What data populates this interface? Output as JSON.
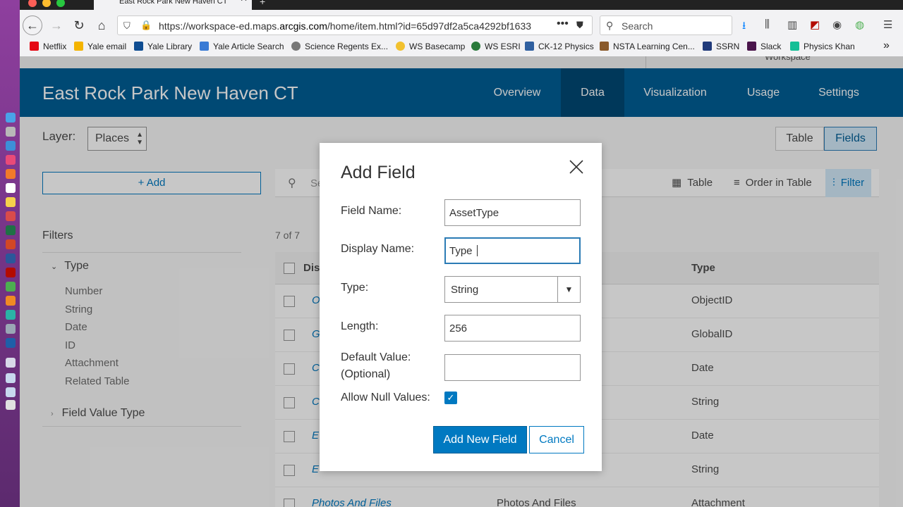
{
  "browser": {
    "tab_title": "East Rock Park New Haven CT",
    "url_prefix": "https://workspace-ed.maps.",
    "url_domain": "arcgis.com",
    "url_rest": "/home/item.html?id=65d97df2a5ca4292bf1633",
    "search_placeholder": "Search",
    "bookmarks": [
      {
        "label": "Netflix",
        "color": "#e50914"
      },
      {
        "label": "Yale email",
        "color": "#f4b400"
      },
      {
        "label": "Yale Library",
        "color": "#0f4d92"
      },
      {
        "label": "Yale Article Search",
        "color": "#3a7bd5"
      },
      {
        "label": "Science Regents Ex...",
        "color": "#555555"
      },
      {
        "label": "WS Basecamp",
        "color": "#f2c12e"
      },
      {
        "label": "WS ESRI",
        "color": "#2a7a3b"
      },
      {
        "label": "CK-12 Physics",
        "color": "#3060a0"
      },
      {
        "label": "NSTA Learning Cen...",
        "color": "#8a5a2b"
      },
      {
        "label": "SSRN",
        "color": "#203a7a"
      },
      {
        "label": "Slack",
        "color": "#4a154b"
      },
      {
        "label": "Physics Khan",
        "color": "#14bf96"
      }
    ]
  },
  "page": {
    "top_strip_text": "Workspace",
    "title": "East Rock Park New Haven CT",
    "tabs": [
      {
        "label": "Overview"
      },
      {
        "label": "Data"
      },
      {
        "label": "Visualization"
      },
      {
        "label": "Usage"
      },
      {
        "label": "Settings"
      }
    ],
    "layer_label": "Layer:",
    "layer_value": "Places",
    "view_buttons": {
      "table": "Table",
      "fields": "Fields"
    },
    "add_label": "+ Add",
    "search_placeholder": "Se",
    "toolbar": {
      "table": "Table",
      "order": "Order in Table",
      "filter": "Filter"
    },
    "filters": {
      "title": "Filters",
      "type_heading": "Type",
      "items": [
        "Number",
        "String",
        "Date",
        "ID",
        "Attachment",
        "Related Table"
      ],
      "field_value_type": "Field Value Type"
    },
    "count": "7 of 7",
    "table": {
      "col_display": "Dis",
      "col_type": "Type",
      "rows": [
        {
          "display": "O",
          "name": "",
          "type": "ObjectID"
        },
        {
          "display": "G",
          "name": "",
          "type": "GlobalID"
        },
        {
          "display": "C",
          "name": "",
          "type": "Date"
        },
        {
          "display": "C",
          "name": "",
          "type": "String"
        },
        {
          "display": "E",
          "name": "",
          "type": "Date"
        },
        {
          "display": "E",
          "name": "",
          "type": "String"
        },
        {
          "display": "Photos And Files",
          "name": "Photos And Files",
          "type": "Attachment"
        }
      ]
    }
  },
  "modal": {
    "title": "Add Field",
    "field_name_label": "Field Name:",
    "field_name_value": "AssetType",
    "display_name_label": "Display Name:",
    "display_name_value": "Type ",
    "type_label": "Type:",
    "type_value": "String",
    "length_label": "Length:",
    "length_value": "256",
    "default_label_1": "Default Value:",
    "default_label_2": "(Optional)",
    "default_value": "",
    "allow_null_label": "Allow Null Values:",
    "allow_null_checked": true,
    "add_button": "Add New Field",
    "cancel_button": "Cancel"
  }
}
